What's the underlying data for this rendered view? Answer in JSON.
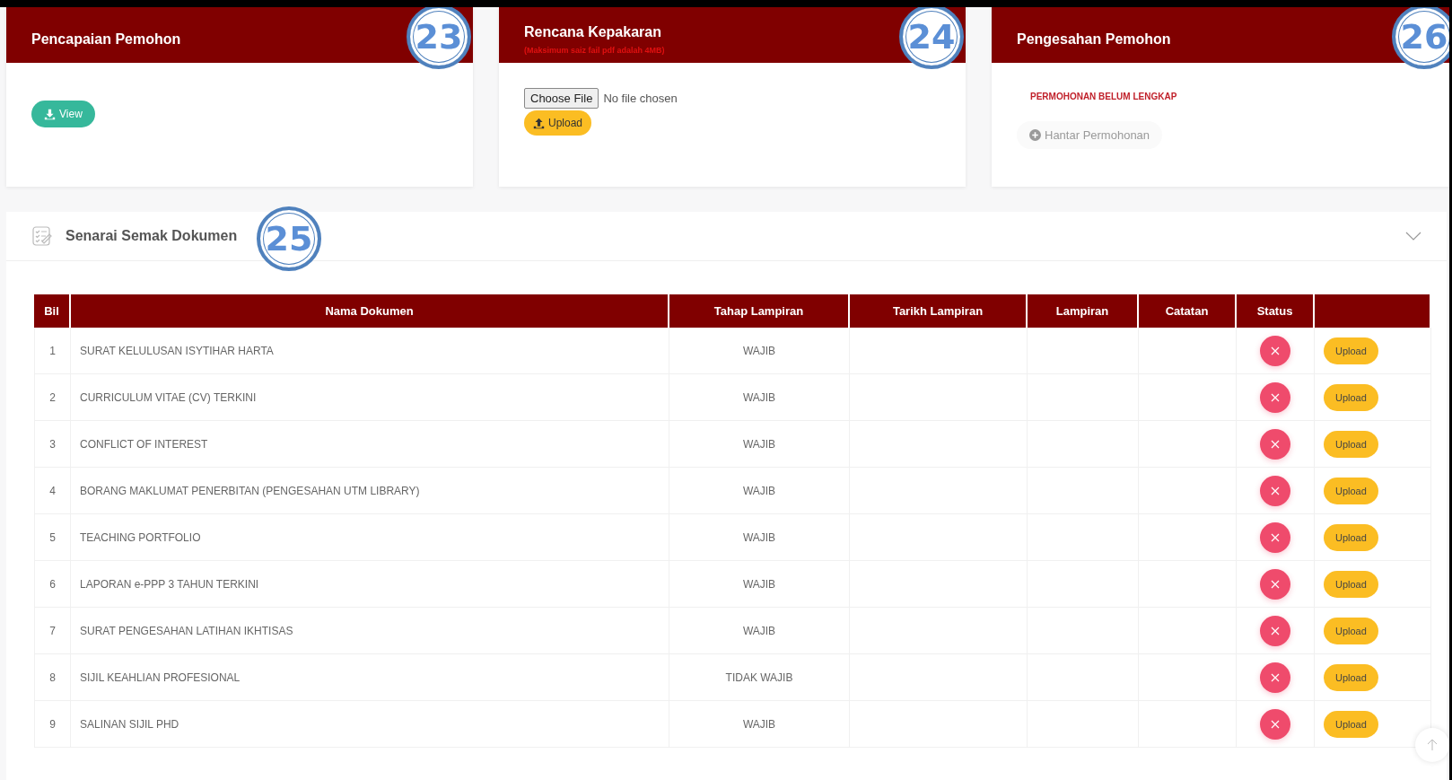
{
  "cards": [
    {
      "kind": "view",
      "title": "Pencapaian Pemohon",
      "callout": "23",
      "button": "View"
    },
    {
      "kind": "file",
      "title": "Rencana Kepakaran",
      "note": "(Maksimum saiz fail pdf adalah 4MB)",
      "callout": "24",
      "file_button": "Choose File",
      "file_status": "No file chosen",
      "button": "Upload"
    },
    {
      "kind": "submit",
      "title": "Pengesahan Pemohon",
      "callout": "26",
      "warning": "PERMOHONAN BELUM LENGKAP",
      "button": "Hantar Permohonan",
      "disabled": true
    }
  ],
  "checklist": {
    "title": "Senarai Semak Dokumen",
    "callout": "25",
    "expanded": true,
    "columns": [
      "Bil",
      "Nama Dokumen",
      "Tahap Lampiran",
      "Tarikh Lampiran",
      "Lampiran",
      "Catatan",
      "Status"
    ],
    "rows": [
      {
        "bil": "1",
        "name": "SURAT KELULUSAN ISYTIHAR HARTA",
        "level": "WAJIB",
        "uploaded": false,
        "action": "Upload"
      },
      {
        "bil": "2",
        "name": "CURRICULUM VITAE (CV) TERKINI",
        "level": "WAJIB",
        "uploaded": false,
        "action": "Upload"
      },
      {
        "bil": "3",
        "name": "CONFLICT OF INTEREST",
        "level": "WAJIB",
        "uploaded": false,
        "action": "Upload"
      },
      {
        "bil": "4",
        "name": "BORANG MAKLUMAT PENERBITAN (PENGESAHAN UTM LIBRARY)",
        "level": "WAJIB",
        "uploaded": false,
        "action": "Upload"
      },
      {
        "bil": "5",
        "name": "TEACHING PORTFOLIO",
        "level": "WAJIB",
        "uploaded": false,
        "action": "Upload"
      },
      {
        "bil": "6",
        "name": "LAPORAN e-PPP 3 TAHUN TERKINI",
        "level": "WAJIB",
        "uploaded": false,
        "action": "Upload"
      },
      {
        "bil": "7",
        "name": "SURAT PENGESAHAN LATIHAN IKHTISAS",
        "level": "WAJIB",
        "uploaded": false,
        "action": "Upload"
      },
      {
        "bil": "8",
        "name": "SIJIL KEAHLIAN PROFESIONAL",
        "level": "TIDAK WAJIB",
        "uploaded": false,
        "action": "Upload"
      },
      {
        "bil": "9",
        "name": "SALINAN SIJIL PHD",
        "level": "WAJIB",
        "uploaded": false,
        "action": "Upload"
      }
    ]
  }
}
